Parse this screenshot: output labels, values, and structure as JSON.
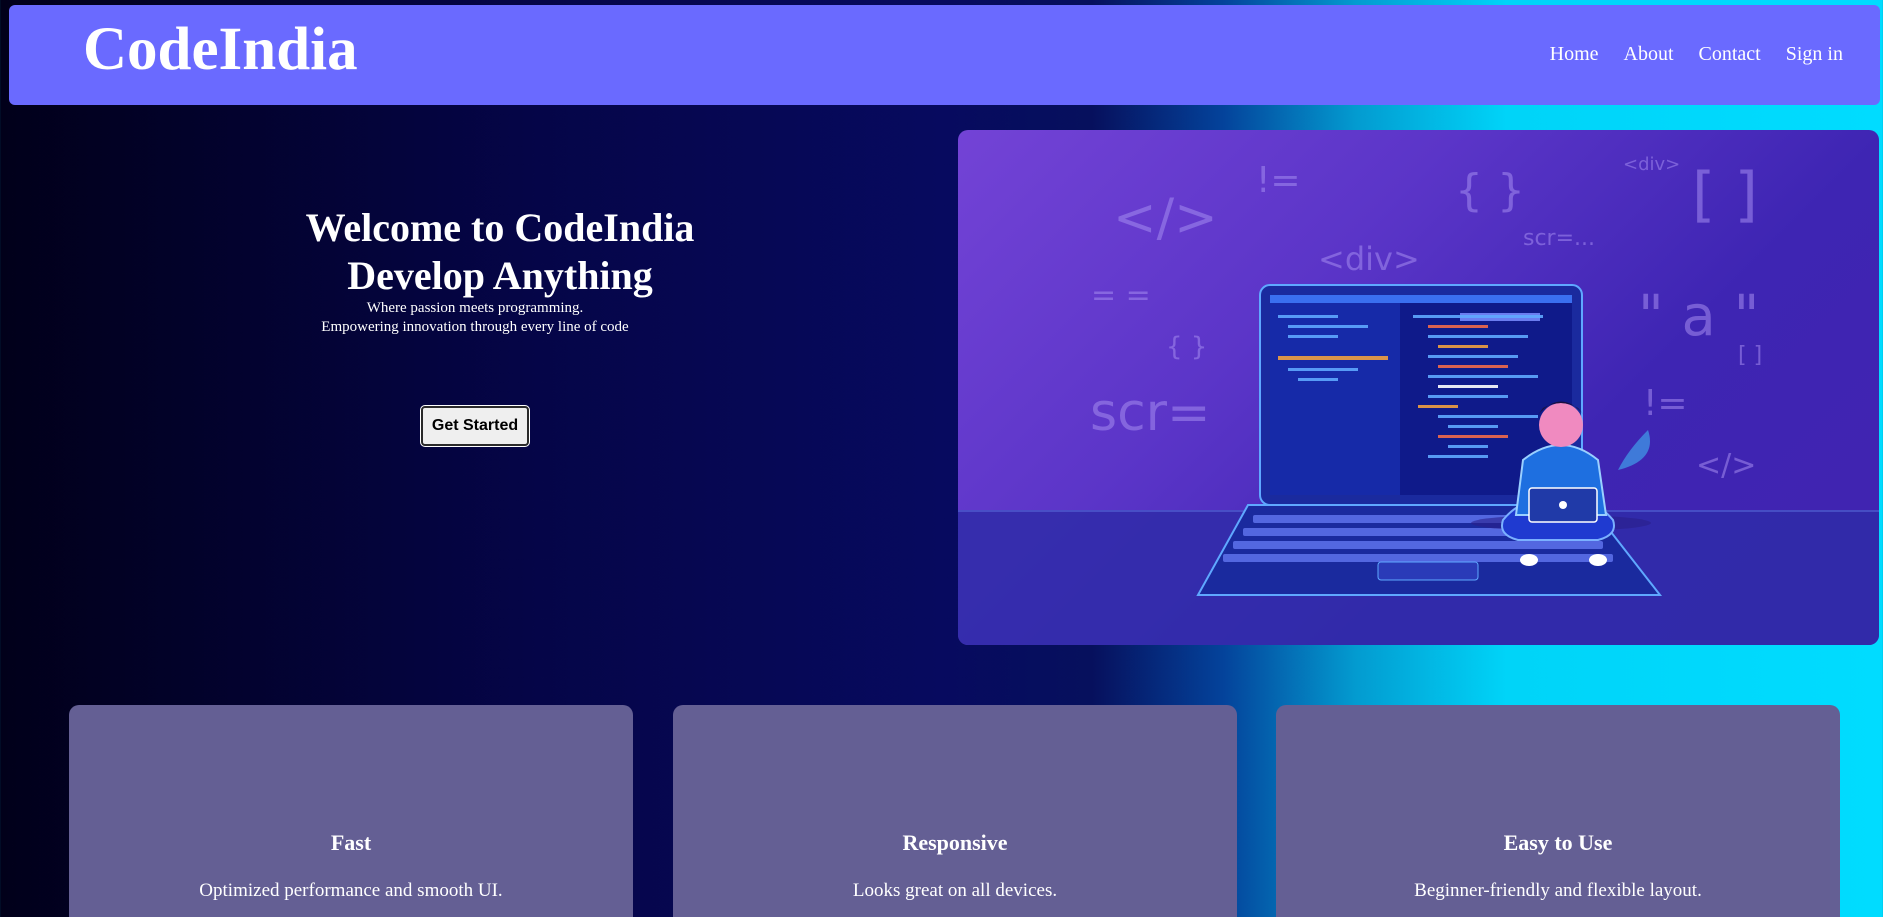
{
  "header": {
    "logo": "CodeIndia",
    "nav": [
      "Home",
      "About",
      "Contact",
      "Sign in"
    ]
  },
  "hero": {
    "title_line1": "Welcome to CodeIndia",
    "title_line2": "Develop Anything",
    "subtitle_line1": "Where passion meets programming.",
    "subtitle_line2": "Empowering innovation through every line of code",
    "cta_label": "Get Started"
  },
  "illustration": {
    "symbols": [
      "</>",
      "!=",
      "{ }",
      "<div>",
      "[ ]",
      "<div>",
      "scr=...",
      "= =",
      "\" a \"",
      "{ }",
      "[ ]",
      "scr=",
      "!=",
      "</>"
    ]
  },
  "features": [
    {
      "title": "Fast",
      "description": "Optimized performance and smooth UI."
    },
    {
      "title": "Responsive",
      "description": "Looks great on all devices."
    },
    {
      "title": "Easy to Use",
      "description": "Beginner-friendly and flexible layout."
    }
  ],
  "colors": {
    "navbar": "#6a6aff",
    "card": "#645f94",
    "accent_cyan": "#00dcff",
    "deep_navy": "#070a5f"
  }
}
